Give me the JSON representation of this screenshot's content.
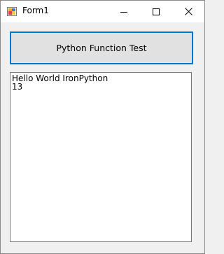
{
  "window": {
    "title": "Form1",
    "icons": {
      "app": "form-app-icon",
      "minimize": "minimize-icon",
      "maximize": "maximize-icon",
      "close": "close-icon"
    }
  },
  "main": {
    "button_label": "Python Function Test",
    "output_lines": [
      "Hello World IronPython",
      "13"
    ]
  },
  "colors": {
    "accent": "#0078d7",
    "button_face": "#e1e1e1",
    "form_background": "#f0f0f0",
    "titlebar_background": "#ffffff"
  }
}
